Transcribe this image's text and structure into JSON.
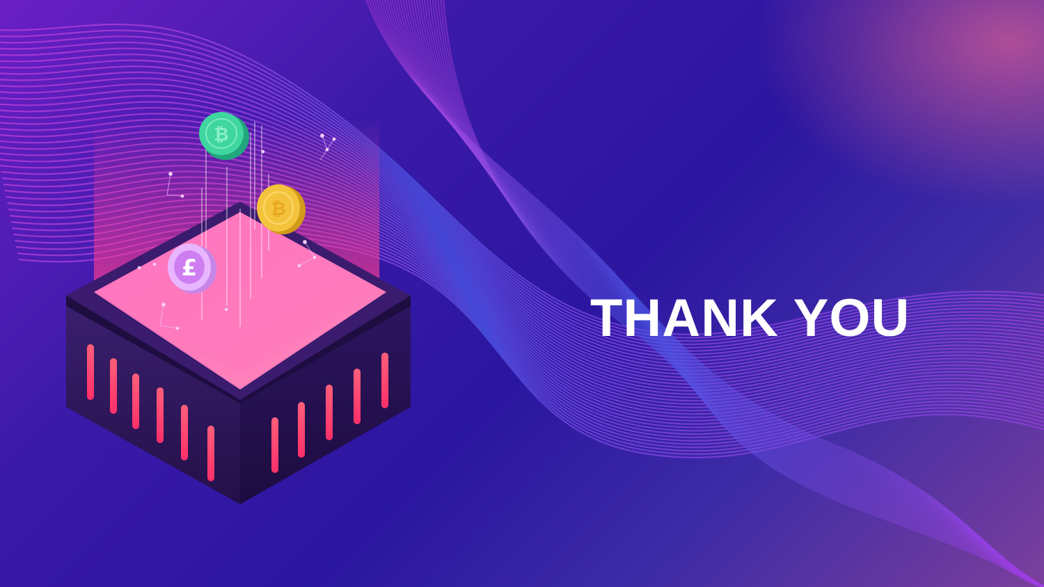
{
  "slide": {
    "title": "THANK YOU"
  },
  "coins": [
    {
      "icon": "bitcoin-icon",
      "symbol": "₿",
      "color": "#3fd6a0"
    },
    {
      "icon": "bitcoin-icon",
      "symbol": "₿",
      "color": "#f3c33c"
    },
    {
      "icon": "pound-icon",
      "symbol": "£",
      "color": "#e0a2ff"
    }
  ],
  "colors": {
    "background_deep": "#2b16a0",
    "background_violet": "#6a1fc4",
    "accent_pink": "#ff4fa3",
    "wave_lines": "#5a4fe0",
    "text": "#ffffff"
  }
}
